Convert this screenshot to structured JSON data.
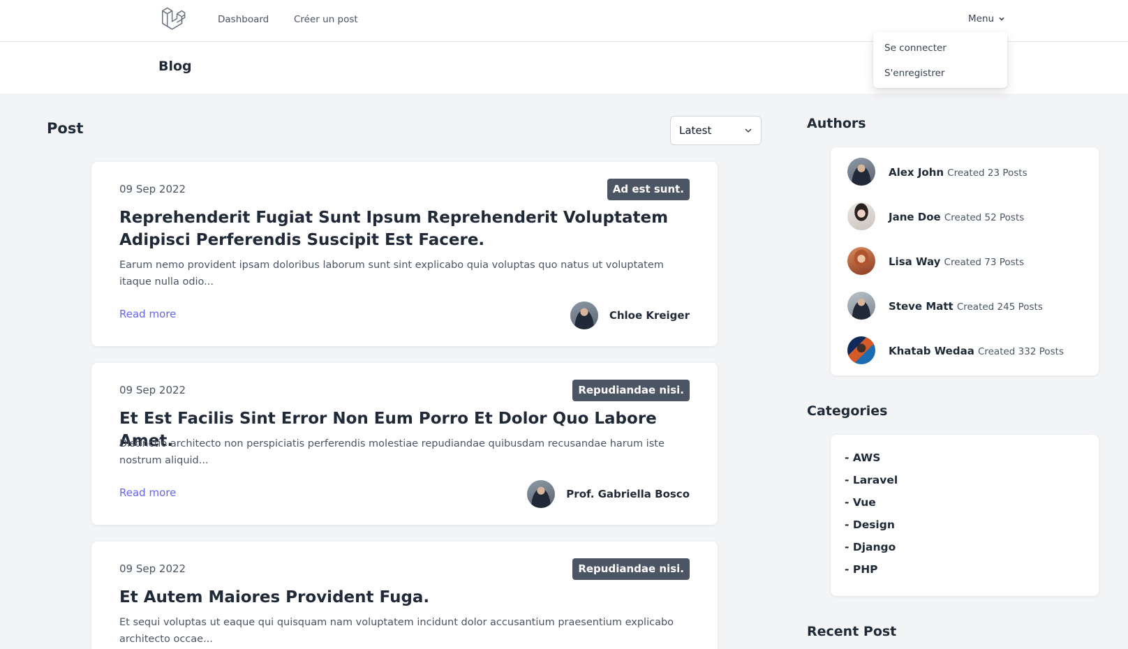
{
  "nav": {
    "links": [
      "Dashboard",
      "Créer un post"
    ],
    "menu_label": "Menu",
    "dropdown": [
      "Se connecter",
      "S'enregistrer"
    ]
  },
  "header": {
    "title": "Blog"
  },
  "posts_section": {
    "title": "Post",
    "sort_value": "Latest",
    "posts": [
      {
        "date": "09 Sep 2022",
        "category": "Ad est sunt.",
        "title": "Reprehenderit Fugiat Sunt Ipsum Reprehenderit Voluptatem Adipisci Perferendis Suscipit Est Facere.",
        "excerpt": "Earum nemo provident ipsam doloribus laborum sunt sint explicabo quia voluptas quo natus ut voluptatem itaque nulla odio...",
        "read_more": "Read more",
        "author": "Chloe Kreiger"
      },
      {
        "date": "09 Sep 2022",
        "category": "Repudiandae nisi.",
        "title": "Et Est Facilis Sint Error Non Eum Porro Et Dolor Quo Labore Amet.",
        "excerpt": "Distinctio architecto non perspiciatis perferendis molestiae repudiandae quibusdam recusandae harum iste nostrum aliquid...",
        "read_more": "Read more",
        "author": "Prof. Gabriella Bosco"
      },
      {
        "date": "09 Sep 2022",
        "category": "Repudiandae nisi.",
        "title": "Et Autem Maiores Provident Fuga.",
        "excerpt": "Et sequi voluptas ut eaque qui quisquam nam voluptatem incidunt dolor accusantium praesentium explicabo architecto occae..."
      }
    ]
  },
  "authors_section": {
    "title": "Authors",
    "authors": [
      {
        "name": "Alex John",
        "count": "Created 23 Posts"
      },
      {
        "name": "Jane Doe",
        "count": "Created 52 Posts"
      },
      {
        "name": "Lisa Way",
        "count": "Created 73 Posts"
      },
      {
        "name": "Steve Matt",
        "count": "Created 245 Posts"
      },
      {
        "name": "Khatab Wedaa",
        "count": "Created 332 Posts"
      }
    ]
  },
  "categories_section": {
    "title": "Categories",
    "items": [
      "- AWS",
      "- Laravel",
      "- Vue",
      "- Design",
      "- Django",
      "- PHP"
    ]
  },
  "recent_section": {
    "title": "Recent Post"
  },
  "colors": {
    "link": "#6366f1",
    "badge": "#4b5563",
    "background": "#f3f4f6"
  }
}
